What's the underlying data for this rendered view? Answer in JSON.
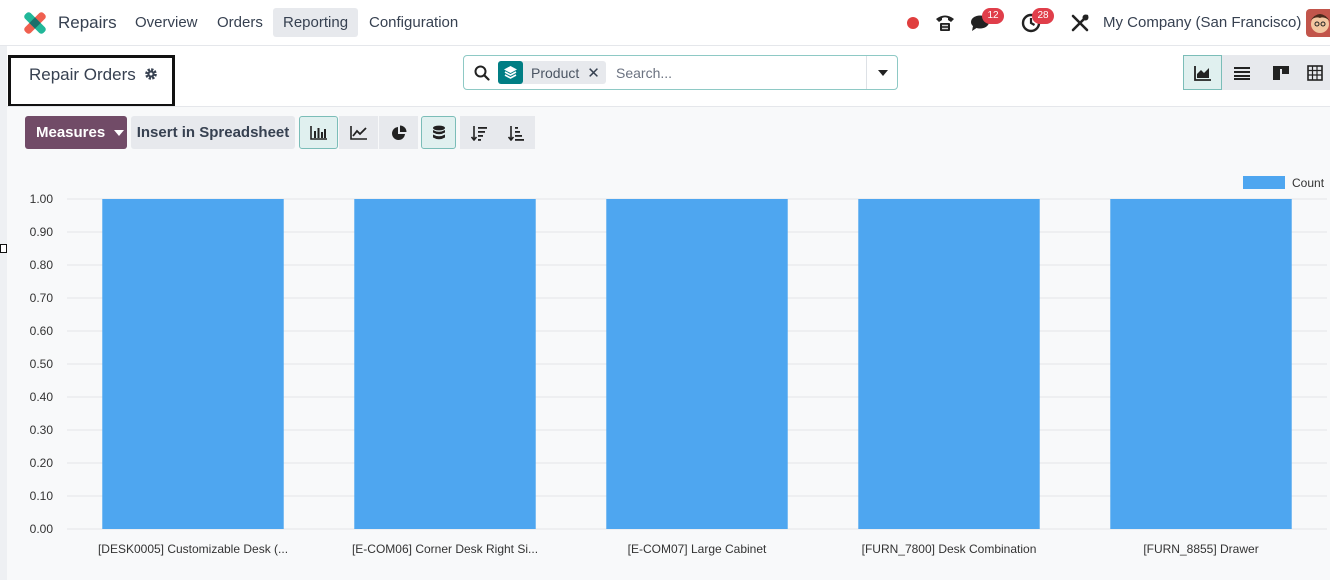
{
  "app": {
    "name": "Repairs"
  },
  "menu": [
    {
      "label": "Overview",
      "active": false
    },
    {
      "label": "Orders",
      "active": false
    },
    {
      "label": "Reporting",
      "active": true
    },
    {
      "label": "Configuration",
      "active": false
    }
  ],
  "systray": {
    "status_dot_color": "#e03e3e",
    "messages_count": "12",
    "activities_count": "28",
    "company": "My Company (San Francisco)"
  },
  "breadcrumb": {
    "title": "Repair Orders"
  },
  "search": {
    "facet_label": "Product",
    "placeholder": "Search..."
  },
  "toolbar": {
    "measures_label": "Measures",
    "insert_label": "Insert in Spreadsheet"
  },
  "colors": {
    "bar": "#4ea6f0",
    "accent": "#714b67",
    "teal": "#017e84"
  },
  "chart_data": {
    "type": "bar",
    "categories": [
      "[DESK0005] Customizable Desk (...",
      "[E-COM06] Corner Desk Right Si...",
      "[E-COM07] Large Cabinet",
      "[FURN_7800] Desk Combination",
      "[FURN_8855] Drawer"
    ],
    "series": [
      {
        "name": "Count",
        "values": [
          1,
          1,
          1,
          1,
          1
        ]
      }
    ],
    "ylim": [
      0,
      1
    ],
    "yticks": [
      "0.00",
      "0.10",
      "0.20",
      "0.30",
      "0.40",
      "0.50",
      "0.60",
      "0.70",
      "0.80",
      "0.90",
      "1.00"
    ],
    "grid": true,
    "legend": "top-right"
  }
}
